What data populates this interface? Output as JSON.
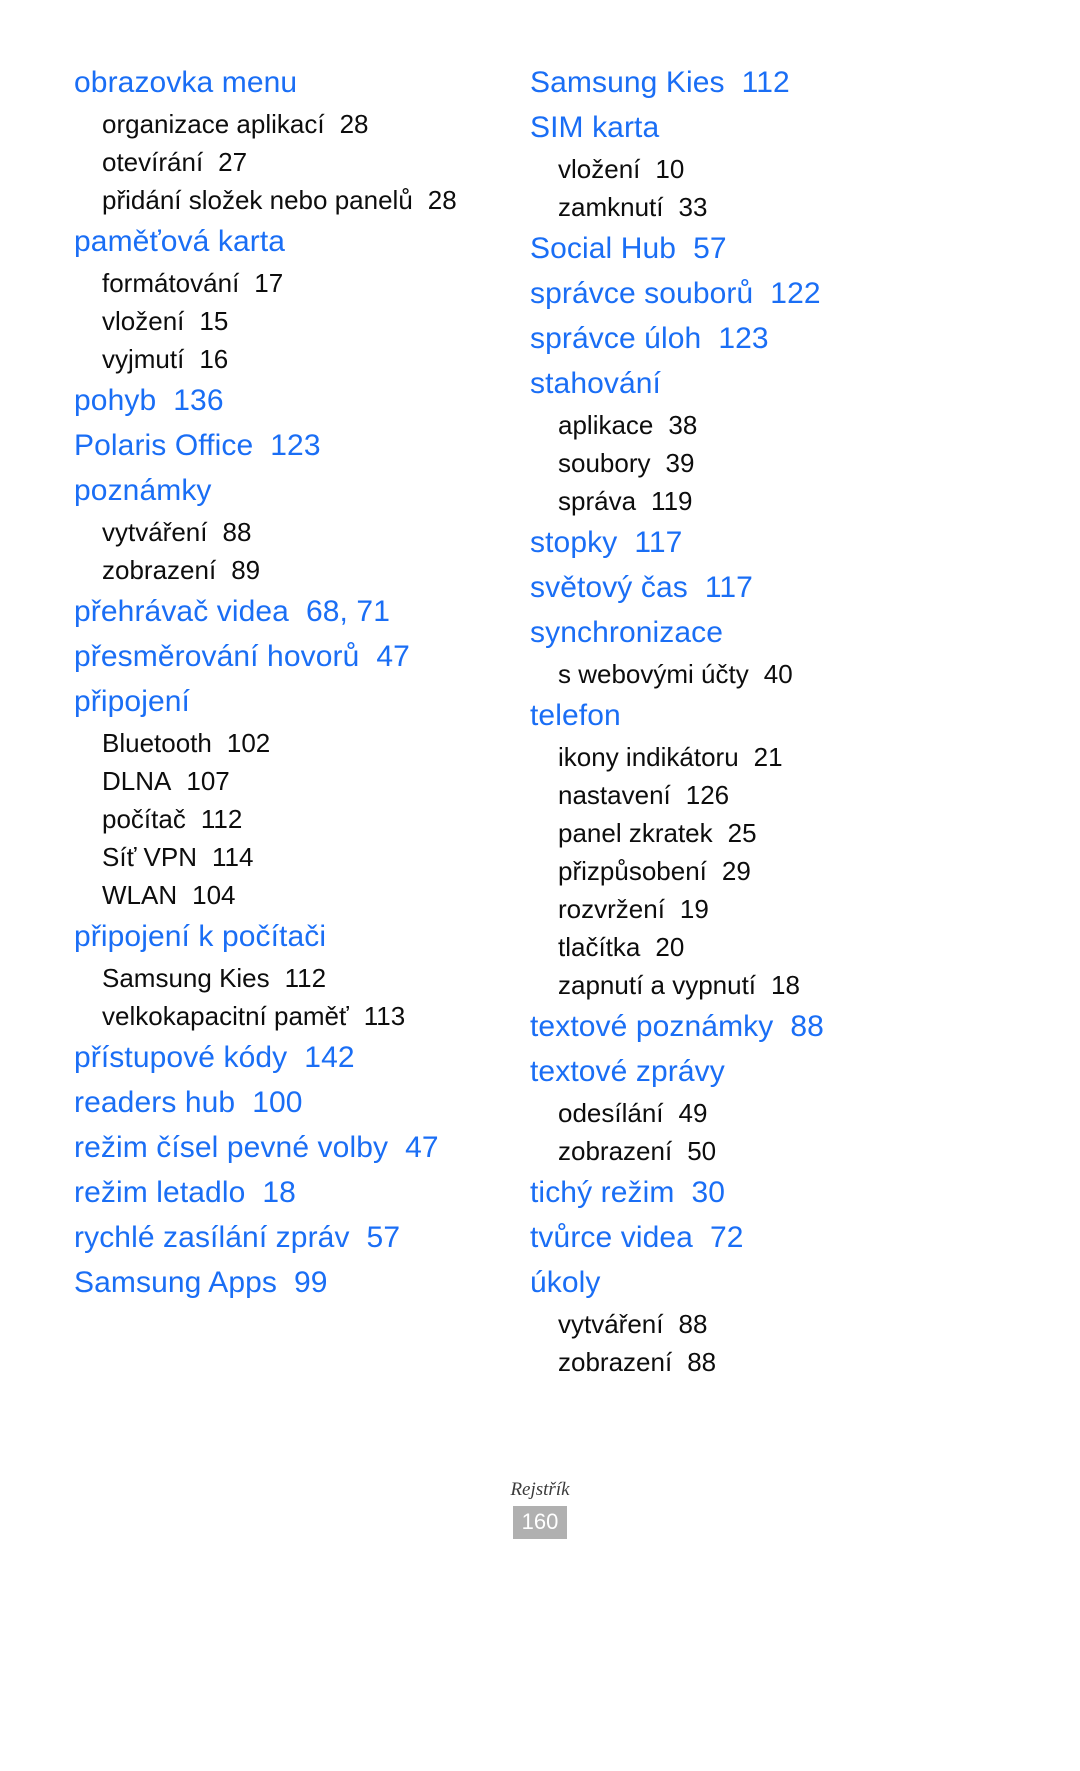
{
  "footer": {
    "label": "Rejstřík",
    "page_number": "160"
  },
  "colors": {
    "heading": "#1a6ef5",
    "body": "#0d0d0d",
    "page_badge_bg": "#b0b0b0"
  },
  "left_column": [
    {
      "heading": "obrazovka menu",
      "page": "",
      "subs": [
        {
          "label": "organizace aplikací",
          "page": "28"
        },
        {
          "label": "otevírání",
          "page": "27"
        },
        {
          "label": "přidání složek nebo panelů",
          "page": "28"
        }
      ]
    },
    {
      "heading": "paměťová karta",
      "page": "",
      "subs": [
        {
          "label": "formátování",
          "page": "17"
        },
        {
          "label": "vložení",
          "page": "15"
        },
        {
          "label": "vyjmutí",
          "page": "16"
        }
      ]
    },
    {
      "heading": "pohyb",
      "page": "136",
      "subs": []
    },
    {
      "heading": "Polaris Office",
      "page": "123",
      "subs": []
    },
    {
      "heading": "poznámky",
      "page": "",
      "subs": [
        {
          "label": "vytváření",
          "page": "88"
        },
        {
          "label": "zobrazení",
          "page": "89"
        }
      ]
    },
    {
      "heading": "přehrávač videa",
      "page": "68, 71",
      "subs": []
    },
    {
      "heading": "přesměrování hovorů",
      "page": "47",
      "subs": []
    },
    {
      "heading": "připojení",
      "page": "",
      "subs": [
        {
          "label": "Bluetooth",
          "page": "102"
        },
        {
          "label": "DLNA",
          "page": "107"
        },
        {
          "label": "počítač",
          "page": "112"
        },
        {
          "label": "Síť VPN",
          "page": "114"
        },
        {
          "label": "WLAN",
          "page": "104"
        }
      ]
    },
    {
      "heading": "připojení k počítači",
      "page": "",
      "subs": [
        {
          "label": "Samsung Kies",
          "page": "112"
        },
        {
          "label": "velkokapacitní paměť",
          "page": "113"
        }
      ]
    },
    {
      "heading": "přístupové kódy",
      "page": "142",
      "subs": []
    },
    {
      "heading": "readers hub",
      "page": "100",
      "subs": []
    },
    {
      "heading": "režim čísel pevné volby",
      "page": "47",
      "subs": []
    },
    {
      "heading": "režim letadlo",
      "page": "18",
      "subs": []
    },
    {
      "heading": "rychlé zasílání zpráv",
      "page": "57",
      "subs": []
    },
    {
      "heading": "Samsung Apps",
      "page": "99",
      "subs": []
    }
  ],
  "right_column": [
    {
      "heading": "Samsung Kies",
      "page": "112",
      "subs": []
    },
    {
      "heading": "SIM karta",
      "page": "",
      "subs": [
        {
          "label": "vložení",
          "page": "10"
        },
        {
          "label": "zamknutí",
          "page": "33"
        }
      ]
    },
    {
      "heading": "Social Hub",
      "page": "57",
      "subs": []
    },
    {
      "heading": "správce souborů",
      "page": "122",
      "subs": []
    },
    {
      "heading": "správce úloh",
      "page": "123",
      "subs": []
    },
    {
      "heading": "stahování",
      "page": "",
      "subs": [
        {
          "label": "aplikace",
          "page": "38"
        },
        {
          "label": "soubory",
          "page": "39"
        },
        {
          "label": "správa",
          "page": "119"
        }
      ]
    },
    {
      "heading": "stopky",
      "page": "117",
      "subs": []
    },
    {
      "heading": "světový čas",
      "page": "117",
      "subs": []
    },
    {
      "heading": "synchronizace",
      "page": "",
      "subs": [
        {
          "label": "s webovými účty",
          "page": "40"
        }
      ]
    },
    {
      "heading": "telefon",
      "page": "",
      "subs": [
        {
          "label": "ikony indikátoru",
          "page": "21"
        },
        {
          "label": "nastavení",
          "page": "126"
        },
        {
          "label": "panel zkratek",
          "page": "25"
        },
        {
          "label": "přizpůsobení",
          "page": "29"
        },
        {
          "label": "rozvržení",
          "page": "19"
        },
        {
          "label": "tlačítka",
          "page": "20"
        },
        {
          "label": "zapnutí a vypnutí",
          "page": "18"
        }
      ]
    },
    {
      "heading": "textové poznámky",
      "page": "88",
      "subs": []
    },
    {
      "heading": "textové zprávy",
      "page": "",
      "subs": [
        {
          "label": "odesílání",
          "page": "49"
        },
        {
          "label": "zobrazení",
          "page": "50"
        }
      ]
    },
    {
      "heading": "tichý režim",
      "page": "30",
      "subs": []
    },
    {
      "heading": "tvůrce videa",
      "page": "72",
      "subs": []
    },
    {
      "heading": "úkoly",
      "page": "",
      "subs": [
        {
          "label": "vytváření",
          "page": "88"
        },
        {
          "label": "zobrazení",
          "page": "88"
        }
      ]
    }
  ]
}
